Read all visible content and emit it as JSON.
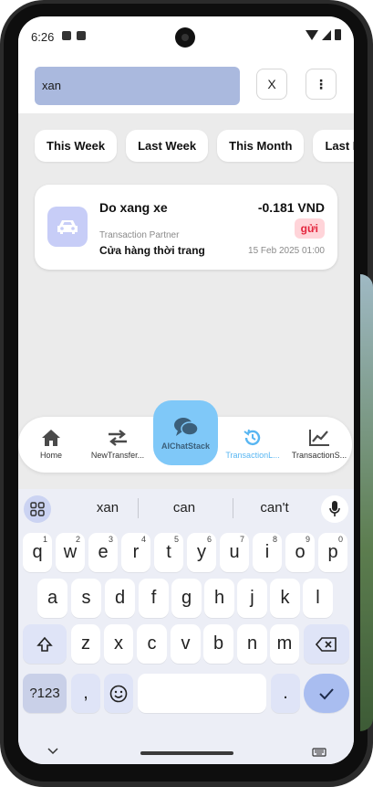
{
  "status_bar": {
    "time": "6:26"
  },
  "search": {
    "value": "xan",
    "clear_label": "X",
    "menu_label": "⋮"
  },
  "filters": [
    "This Week",
    "Last Week",
    "This Month",
    "Last Month"
  ],
  "transaction": {
    "title": "Do xang xe",
    "amount": "-0.181 VND",
    "status": "gửi",
    "partner_label": "Transaction Partner",
    "partner": "Cửa hàng thời trang",
    "date": "15 Feb 2025 01:00"
  },
  "bottom_nav": {
    "items": [
      {
        "label": "Home",
        "icon": "home-icon"
      },
      {
        "label": "NewTransfer...",
        "icon": "transfer-icon"
      },
      {
        "label": "AIChatStack",
        "icon": "chat-icon"
      },
      {
        "label": "TransactionL...",
        "icon": "history-icon"
      },
      {
        "label": "TransactionS...",
        "icon": "chart-icon"
      }
    ],
    "active": "TransactionL..."
  },
  "keyboard": {
    "suggestions": [
      "xan",
      "can",
      "can't"
    ],
    "row1": [
      {
        "k": "q",
        "h": "1"
      },
      {
        "k": "w",
        "h": "2"
      },
      {
        "k": "e",
        "h": "3"
      },
      {
        "k": "r",
        "h": "4"
      },
      {
        "k": "t",
        "h": "5"
      },
      {
        "k": "y",
        "h": "6"
      },
      {
        "k": "u",
        "h": "7"
      },
      {
        "k": "i",
        "h": "8"
      },
      {
        "k": "o",
        "h": "9"
      },
      {
        "k": "p",
        "h": "0"
      }
    ],
    "row2": [
      "a",
      "s",
      "d",
      "f",
      "g",
      "h",
      "j",
      "k",
      "l"
    ],
    "row3": [
      "z",
      "x",
      "c",
      "v",
      "b",
      "n",
      "m"
    ],
    "symbols_label": "?123",
    "comma": ",",
    "period": "."
  },
  "colors": {
    "accent": "#58b6f2",
    "search_bg": "#aab9de",
    "status_badge_bg": "#ffd4d9",
    "status_badge_text": "#e3253d"
  }
}
